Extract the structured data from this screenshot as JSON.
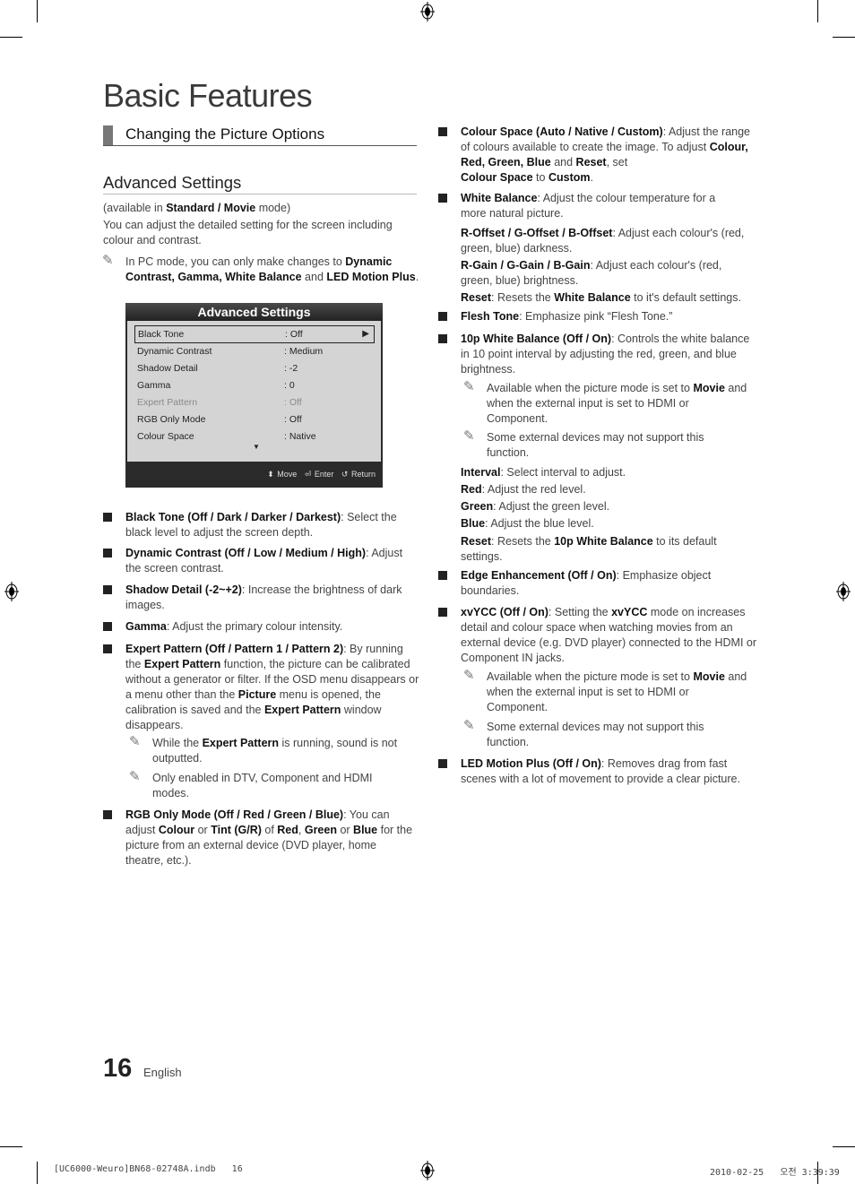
{
  "page": {
    "chapter_title": "Basic Features",
    "section_title": "Changing the Picture Options",
    "subsection_title": "Advanced Settings",
    "availability": {
      "pre": "(available in ",
      "bold": "Standard / Movie",
      "post": " mode)"
    },
    "intro": "You can adjust the detailed setting for the screen including colour and contrast.",
    "pc_note": {
      "pre": "In PC mode, you can only make changes to ",
      "bold1": "Dynamic Contrast, Gamma, White Balance",
      "mid": " and ",
      "bold2": "LED Motion Plus",
      "post": "."
    },
    "page_number": "16",
    "language": "English"
  },
  "osd": {
    "title": "Advanced Settings",
    "rows": [
      {
        "name": "Black Tone",
        "value": ": Off",
        "selected": true
      },
      {
        "name": "Dynamic Contrast",
        "value": ": Medium"
      },
      {
        "name": "Shadow Detail",
        "value": ": -2"
      },
      {
        "name": "Gamma",
        "value": ": 0"
      },
      {
        "name": "Expert Pattern",
        "value": ": Off",
        "disabled": true
      },
      {
        "name": "RGB Only Mode",
        "value": ": Off"
      },
      {
        "name": "Colour Space",
        "value": ": Native"
      }
    ],
    "right_arrow": "▶",
    "more_arrow": "▼",
    "footer": {
      "move_icon": "⬍",
      "move": "Move",
      "enter_icon": "⏎",
      "enter": "Enter",
      "return_icon": "↺",
      "return": "Return"
    }
  },
  "left_items": [
    {
      "bold": "Black Tone (Off / Dark / Darker / Darkest)",
      "text": ": Select the black level to adjust the screen depth."
    },
    {
      "bold": "Dynamic Contrast (Off / Low / Medium / High)",
      "text": ": Adjust the screen contrast."
    },
    {
      "bold": "Shadow Detail (-2~+2)",
      "text": ": Increase the brightness of dark images."
    },
    {
      "bold": "Gamma",
      "text": ": Adjust the primary colour intensity."
    },
    {
      "bold": "Expert Pattern (Off / Pattern 1 / Pattern 2)",
      "text": ": By running the ",
      "b2": "Expert Pattern",
      "t2": " function, the picture can be calibrated without a generator or filter. If the OSD menu disappears or a menu other than the ",
      "b3": "Picture",
      "t3": " menu is opened, the calibration is saved and the ",
      "b4": "Expert Pattern",
      "t4": " window disappears."
    },
    {
      "bold": "RGB Only Mode (Off / Red / Green / Blue)",
      "text": ": You can adjust ",
      "b2": "Colour",
      "t2": " or ",
      "b3": "Tint (G/R)",
      "t3": " of ",
      "b4": "Red",
      "t4": ", ",
      "b5": "Green",
      "t5": " or ",
      "b6": "Blue",
      "t6": " for the picture from an external device (DVD player, home theatre, etc.)."
    }
  ],
  "expert_notes": [
    {
      "pre": "While the ",
      "bold": "Expert Pattern",
      "post": " is running, sound is not outputted."
    },
    {
      "pre": "Only enabled in DTV, Component and HDMI modes.",
      "bold": "",
      "post": ""
    }
  ],
  "right_items": {
    "colour_space": {
      "bold": "Colour Space (Auto / Native / Custom)",
      "text": ": Adjust the range of colours available to create the image. To adjust ",
      "b2": "Colour, Red, Green, Blue",
      "t2": " and ",
      "b3": "Reset",
      "t3": ", set ",
      "b4": "Colour Space",
      "t4": " to ",
      "b5": "Custom",
      "t5": "."
    },
    "white_balance": {
      "bold": "White Balance",
      "text": ": Adjust the colour temperature for a more natural picture."
    },
    "wb_sub": [
      {
        "bold": "R-Offset / G-Offset / B-Offset",
        "text": ": Adjust each colour's (red, green, blue) darkness."
      },
      {
        "bold": "R-Gain / G-Gain / B-Gain",
        "text": ": Adjust each colour's (red, green, blue) brightness."
      },
      {
        "bold": "Reset",
        "text": ": Resets the ",
        "b2": "White Balance",
        "t2": " to it's default settings."
      }
    ],
    "flesh_tone": {
      "bold": "Flesh Tone",
      "text": ": Emphasize pink “Flesh Tone.”"
    },
    "wb10": {
      "bold": "10p White Balance (Off / On)",
      "text": ": Controls the white balance in 10 point interval by adjusting the red, green, and blue brightness."
    },
    "wb10_notes": [
      {
        "pre": "Available when the picture mode is set to ",
        "bold": "Movie",
        "post": " and when the external input is set to HDMI or Component."
      },
      {
        "pre": "Some external devices may not support this function.",
        "bold": "",
        "post": ""
      }
    ],
    "wb10_sub": [
      {
        "bold": "Interval",
        "text": ": Select interval to adjust."
      },
      {
        "bold": "Red",
        "text": ": Adjust the red level."
      },
      {
        "bold": "Green",
        "text": ": Adjust the green level."
      },
      {
        "bold": "Blue",
        "text": ": Adjust the blue level."
      },
      {
        "bold": "Reset",
        "text": ": Resets the ",
        "b2": "10p White Balance",
        "t2": " to its default settings."
      }
    ],
    "edge": {
      "bold": "Edge Enhancement (Off / On)",
      "text": ": Emphasize object boundaries."
    },
    "xvycc": {
      "bold": "xvYCC (Off / On)",
      "text": ": Setting the ",
      "b2": "xvYCC",
      "t2": " mode on increases detail and colour space when watching movies from an external device (e.g. DVD player) connected to the HDMI or Component IN jacks."
    },
    "xvycc_notes": [
      {
        "pre": "Available when the picture mode is set to ",
        "bold": "Movie",
        "post": " and when the external input is set to HDMI or Component."
      },
      {
        "pre": "Some external devices may not support this function.",
        "bold": "",
        "post": ""
      }
    ],
    "led": {
      "bold": "LED Motion Plus (Off / On)",
      "text": ": Removes drag from fast scenes with a lot of movement to provide a clear picture."
    }
  },
  "print_footer": {
    "file": "[UC6000-Weuro]BN68-02748A.indb   16",
    "date": "2010-02-25   오전 3:39:39"
  },
  "icons": {
    "note": "✎"
  }
}
